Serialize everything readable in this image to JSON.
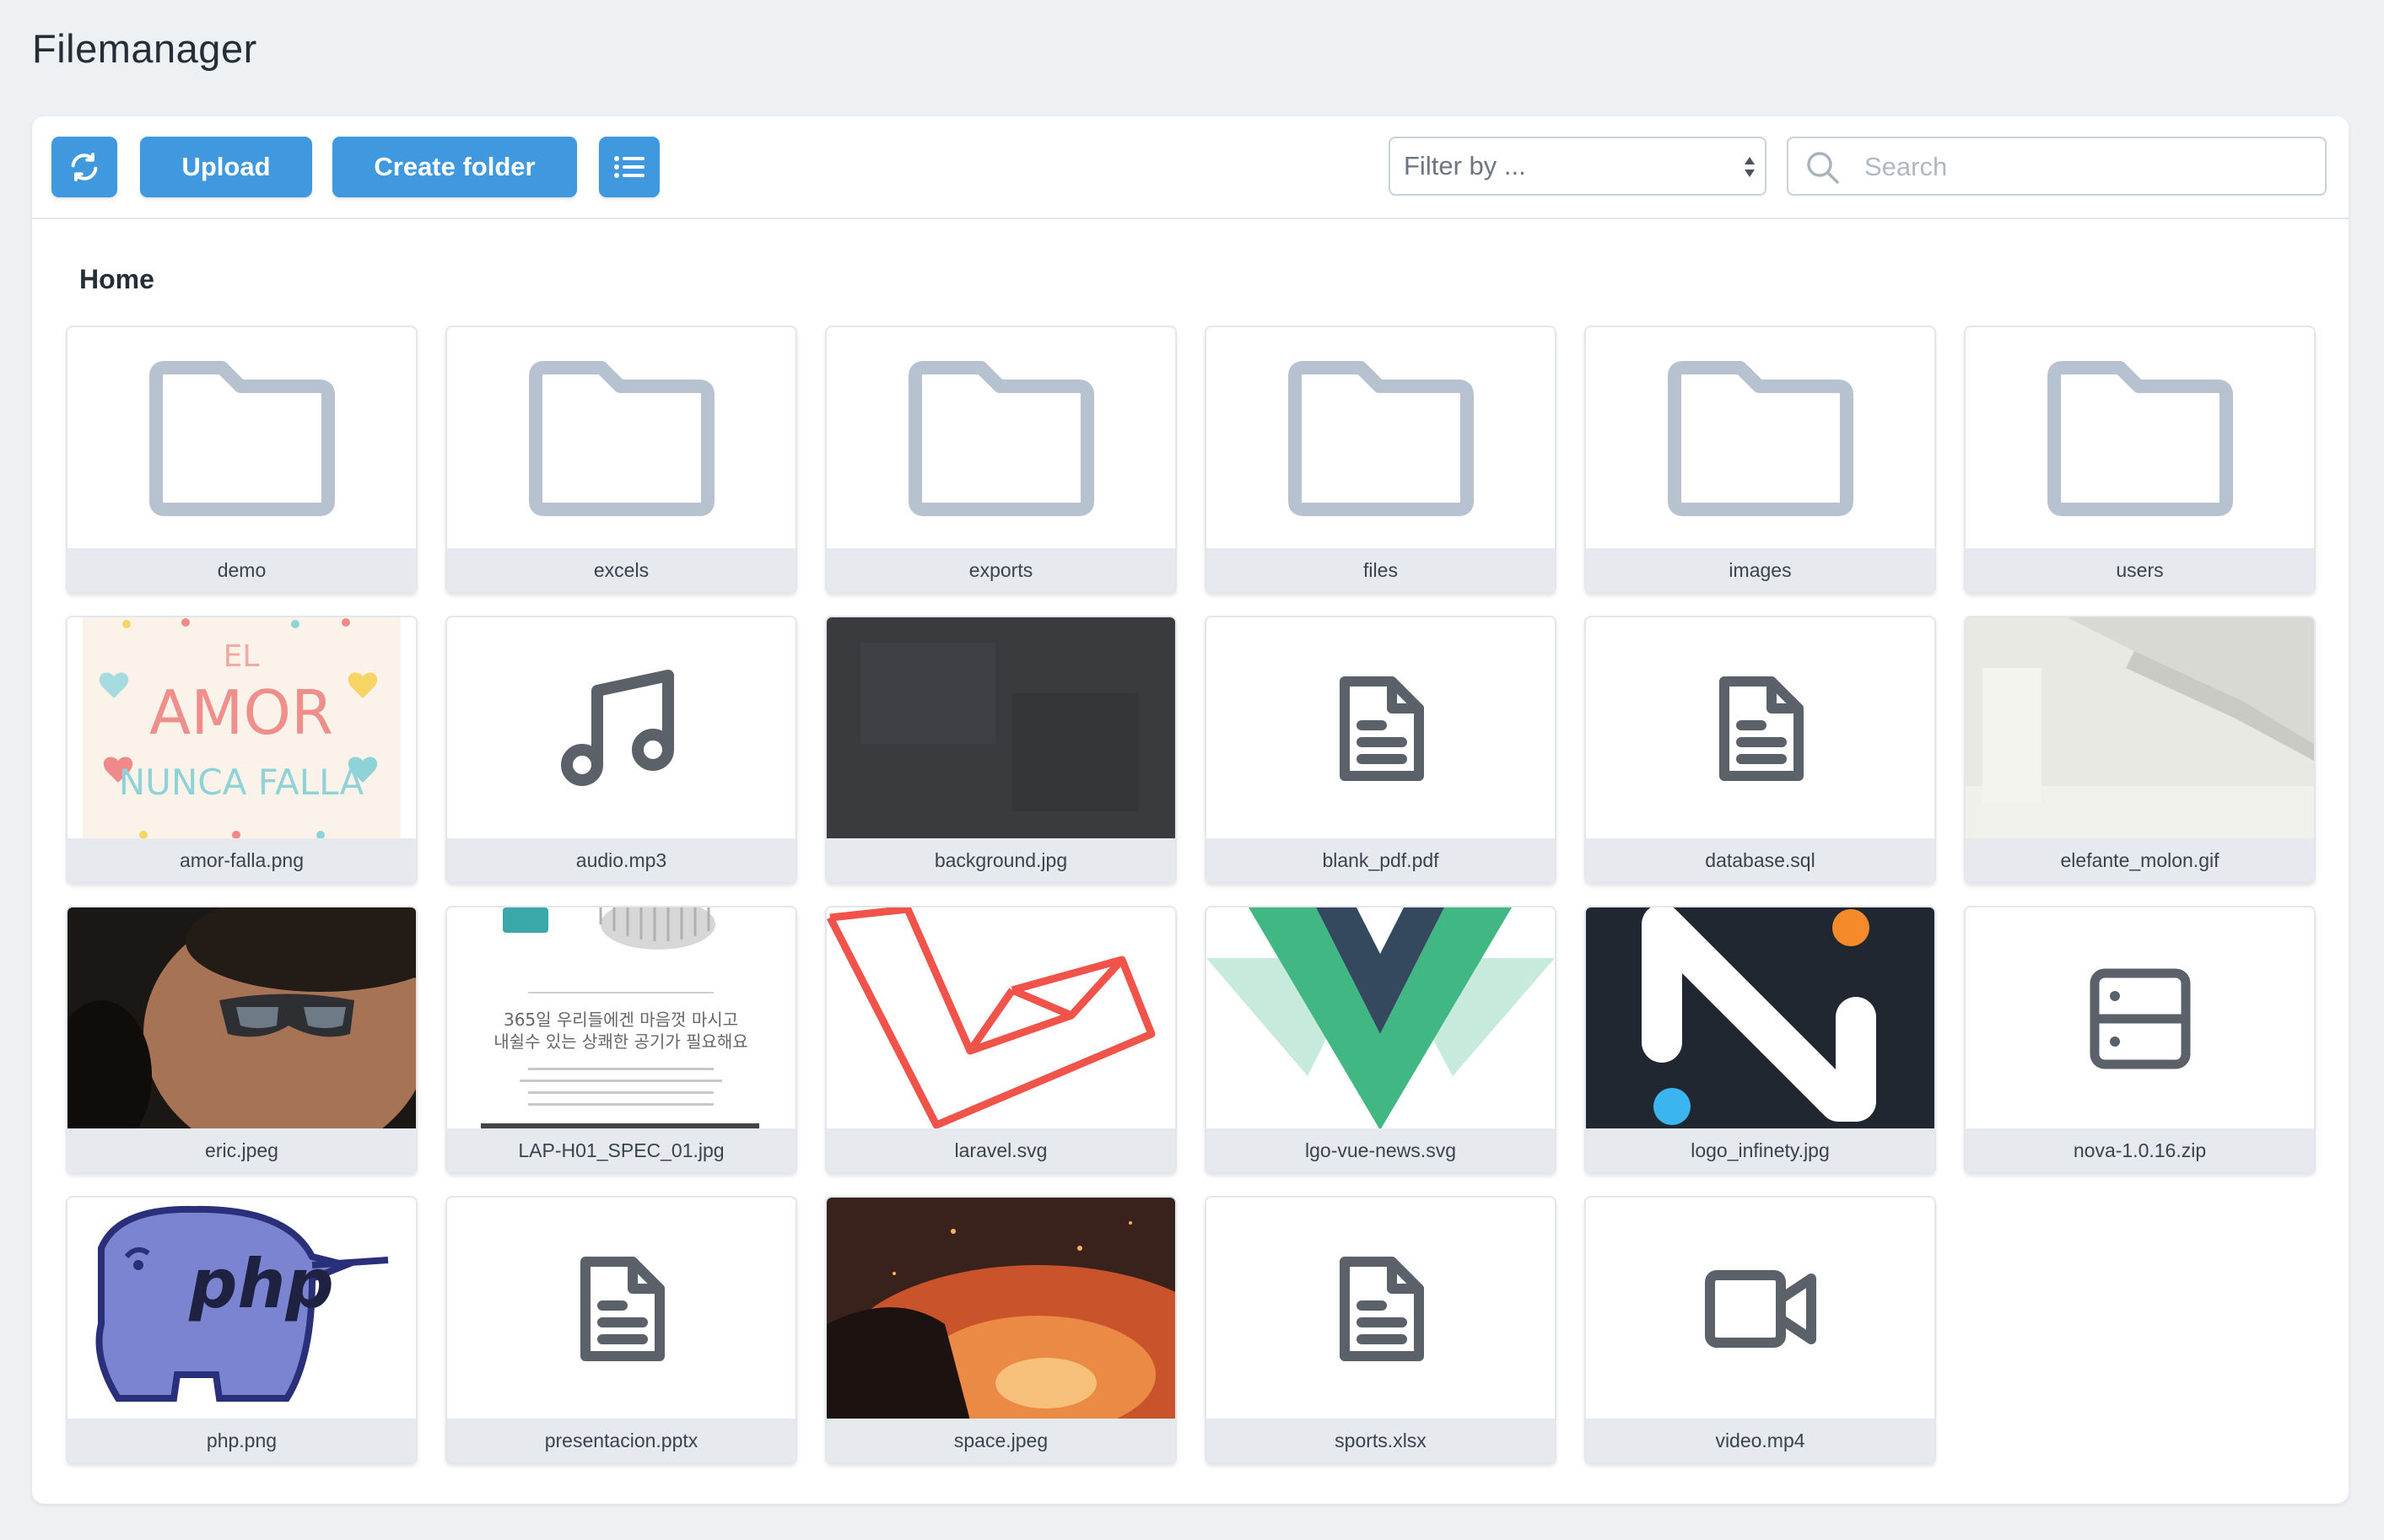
{
  "app": {
    "title": "Filemanager"
  },
  "toolbar": {
    "refresh_icon": "refresh-icon",
    "upload_label": "Upload",
    "create_folder_label": "Create folder",
    "view_toggle_icon": "list-icon",
    "filter_placeholder": "Filter by ...",
    "search_placeholder": "Search",
    "accent_color": "#4099de"
  },
  "breadcrumb": {
    "current": "Home"
  },
  "items": [
    {
      "name": "demo",
      "kind": "folder"
    },
    {
      "name": "excels",
      "kind": "folder"
    },
    {
      "name": "exports",
      "kind": "folder"
    },
    {
      "name": "files",
      "kind": "folder"
    },
    {
      "name": "images",
      "kind": "folder"
    },
    {
      "name": "users",
      "kind": "folder"
    },
    {
      "name": "amor-falla.png",
      "kind": "image",
      "thumb_text": [
        "EL",
        "AMOR",
        "NUNCA FALLA"
      ]
    },
    {
      "name": "audio.mp3",
      "kind": "audio"
    },
    {
      "name": "background.jpg",
      "kind": "image"
    },
    {
      "name": "blank_pdf.pdf",
      "kind": "document"
    },
    {
      "name": "database.sql",
      "kind": "document"
    },
    {
      "name": "elefante_molon.gif",
      "kind": "image"
    },
    {
      "name": "eric.jpeg",
      "kind": "image"
    },
    {
      "name": "LAP-H01_SPEC_01.jpg",
      "kind": "image",
      "thumb_text": [
        "365일 우리들에겐 마음껏 마시고",
        "내쉴수 있는 상쾌한 공기가 필요해요"
      ]
    },
    {
      "name": "laravel.svg",
      "kind": "image"
    },
    {
      "name": "lgo-vue-news.svg",
      "kind": "image"
    },
    {
      "name": "logo_infinety.jpg",
      "kind": "image"
    },
    {
      "name": "nova-1.0.16.zip",
      "kind": "archive"
    },
    {
      "name": "php.png",
      "kind": "image",
      "thumb_text": [
        "php"
      ]
    },
    {
      "name": "presentacion.pptx",
      "kind": "document"
    },
    {
      "name": "space.jpeg",
      "kind": "image"
    },
    {
      "name": "sports.xlsx",
      "kind": "document"
    },
    {
      "name": "video.mp4",
      "kind": "video"
    }
  ]
}
